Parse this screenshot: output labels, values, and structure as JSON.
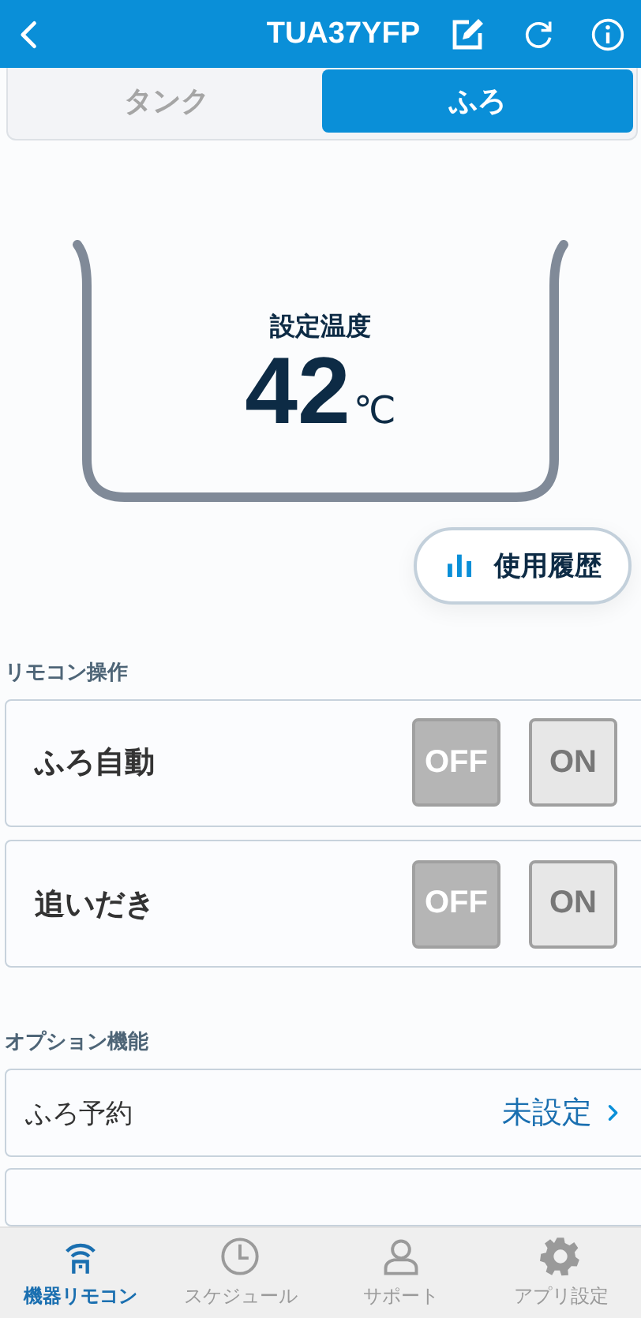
{
  "header": {
    "title": "TUA37YFP"
  },
  "tabs": [
    {
      "label": "タンク",
      "selected": false
    },
    {
      "label": "ふろ",
      "selected": true
    }
  ],
  "tub": {
    "label": "設定温度",
    "value": "42",
    "unit": "℃"
  },
  "history_button": {
    "label": "使用履歴"
  },
  "remote_section": {
    "title": "リモコン操作",
    "rows": [
      {
        "label": "ふろ自動",
        "options": [
          {
            "label": "OFF",
            "selected": true
          },
          {
            "label": "ON",
            "selected": false
          }
        ]
      },
      {
        "label": "追いだき",
        "options": [
          {
            "label": "OFF",
            "selected": true
          },
          {
            "label": "ON",
            "selected": false
          }
        ]
      }
    ]
  },
  "option_section": {
    "title": "オプション機能",
    "rows": [
      {
        "label": "ふろ予約",
        "value": "未設定"
      }
    ]
  },
  "bottom_nav": [
    {
      "kind": "remote",
      "label": "機器リモコン",
      "selected": true
    },
    {
      "kind": "schedule",
      "label": "スケジュール",
      "selected": false
    },
    {
      "kind": "support",
      "label": "サポート",
      "selected": false
    },
    {
      "kind": "settings",
      "label": "アプリ設定",
      "selected": false
    }
  ]
}
